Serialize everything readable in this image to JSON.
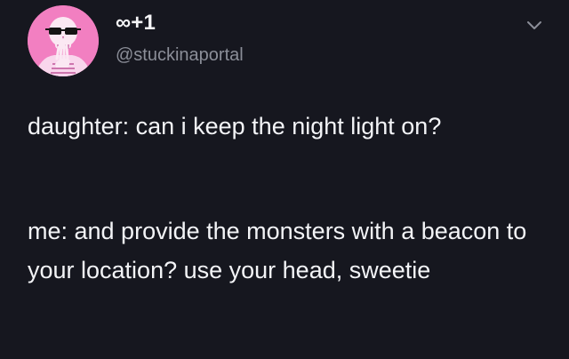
{
  "tweet": {
    "display_name": "∞+1",
    "handle": "@stuckinaportal",
    "paragraphs": [
      "daughter: can i keep the night light on?",
      "me: and provide the monsters with a beacon to your location? use your head, sweetie"
    ]
  },
  "avatar": {
    "description_icon": "skeleton-with-sunglasses-avatar",
    "background_color": "#f27fc1"
  },
  "icons": {
    "menu": "chevron-down-icon"
  },
  "colors": {
    "background": "#16171f",
    "text": "#f3f4f7",
    "handle": "#8b8e98"
  }
}
